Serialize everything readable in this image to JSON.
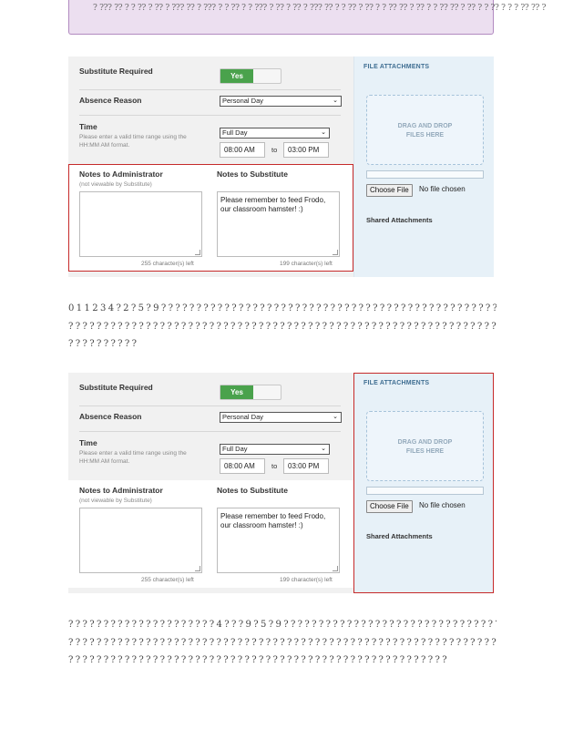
{
  "callout": {
    "text": "? ??? ?? ? ? ?? ? ?? ? ??? ?? ? ??? ? ? ?? ? ? ??? ? ?? ? ?? ? ??? ?? ? ? ?? ? ?? ? ? ?? ?? ? ?? ? ? ?? ?? ? ?? ? ? ?? ? ? ? ?? ?? ?"
  },
  "form": {
    "substitute_required_label": "Substitute Required",
    "toggle_yes": "Yes",
    "absence_reason_label": "Absence Reason",
    "absence_reason_value": "Personal Day",
    "time_label": "Time",
    "time_hint": "Please enter a valid time range using the HH:MM AM format.",
    "time_range_value": "Full Day",
    "start_time": "08:00 AM",
    "to": "to",
    "end_time": "03:00 PM",
    "notes_admin_label": "Notes to Administrator",
    "notes_admin_hint": "(not viewable by Substitute)",
    "notes_admin_counter": "255 character(s) left",
    "notes_sub_label": "Notes to Substitute",
    "notes_sub_value": "Please remember to feed Frodo, our classroom hamster! :)",
    "notes_sub_counter": "199 character(s) left"
  },
  "attachments": {
    "title": "FILE ATTACHMENTS",
    "drop_line1": "DRAG AND DROP",
    "drop_line2": "FILES HERE",
    "choose_file": "Choose File",
    "no_file": "No file chosen",
    "shared": "Shared Attachments"
  },
  "paragraph1": [
    "0  1 1 2 3 4 ? 2 ? 5 ? 9 ? ? ? ? ? ? ? ? ? ? ?   ? ? ? ? ? ?   ? ? ? ? ? ?   ? ? ? ? ? ? ? ? ? ? ?   ? ?   ? ? ? ? ? ? ? ? ? ? ? ? ? ? ? ? ?",
    "? ? ? ? ? ? ? ? ? ? ? ? ? ? ? ? ? ? ? ? ? ? ? ? ? ? ? ? ? ? ? ? ? ? ? ? ? ? ? ? ? ? ? ?   ? ? ? ? ? ? ? ? ? ? ? ? ? ? ? ? ? ? ? ? ? ? ? ? ? ?",
    "? ? ? ? ? ?   ? ? ? ?"
  ],
  "paragraph2": [
    "? ? ? ? ? ? ? ? ? ? ? ?   ? ? ? ? ? ? ? ? ? 4 ? ? ? 9 ? 5 ? 9 ? ? ? ? ? ? ? ? ? ? ? ? ? ? ? ? ? ? ? ? ? ? ? ? ? ? ? ? ? ? ? ? ? ? ? ? ? ? ?",
    "? ?   ? ? ? ? ? ? ? ? ? ? ? ? ? ? ? ? ? ? ? ? ? ? ? ? ? ? ? ? ? ? ? ? ? ? ? ? ? ? ? ? ? ? ? ? ? ? ? ? ? ? ? ? ? ? ? ? ? ? ? ?",
    "? ? ? ? ? ? ? ? ? ? ? ? ? ? ? ? ? ? ? ? ? ? ? ? ? ? ? ? ? ? ? ? ? ? ? ? ? ? ? ? ? ? ? ? ? ? ? ?   ? ? ? ? ? ?"
  ],
  "colors": {
    "toggle_on": "#4aa24c",
    "highlight": "#c62a2a",
    "callout_bg": "#ecdff0",
    "attach_bg": "#e7f1f8"
  },
  "icons": {
    "select": "chevron-down-icon",
    "resize": "resize-grip-icon"
  }
}
